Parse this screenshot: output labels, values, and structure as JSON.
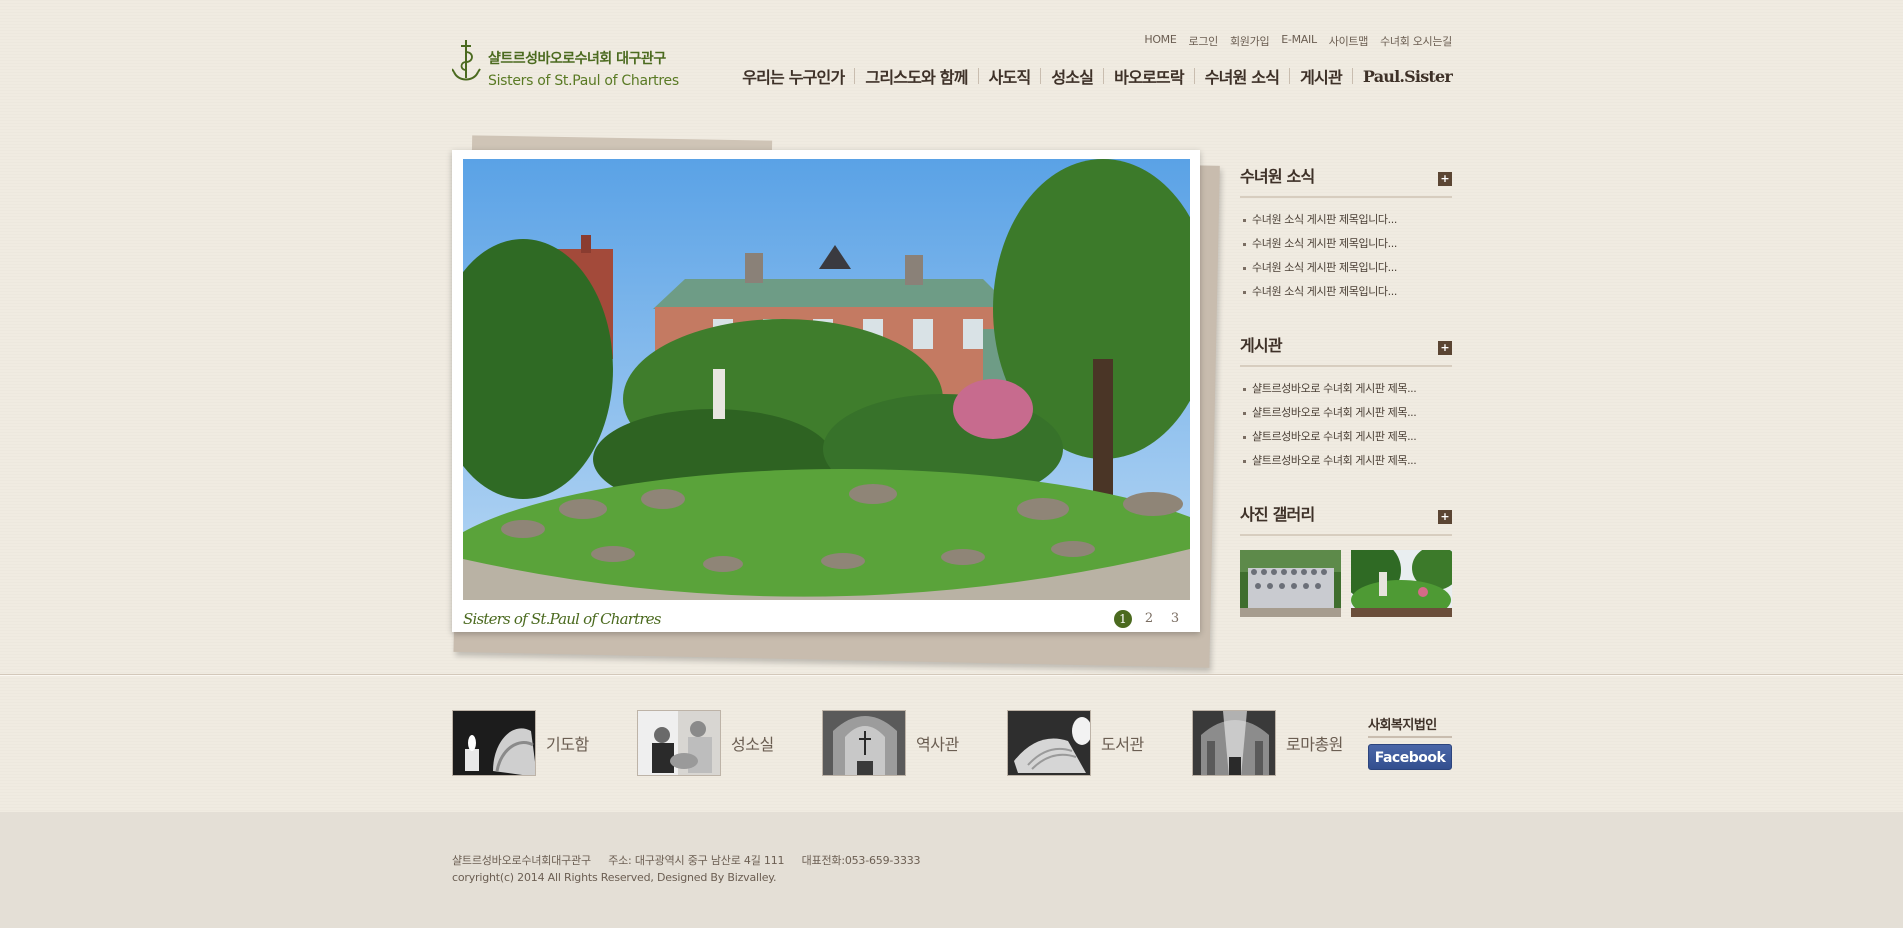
{
  "header": {
    "logo_kr": "샬트르성바오로수녀회 대구관구",
    "logo_en": "Sisters of St.Paul of Chartres",
    "util_nav": [
      "HOME",
      "로그인",
      "회원가입",
      "E-MAIL",
      "사이트맵",
      "수녀회 오시는길"
    ],
    "gnb": [
      "우리는 누구인가",
      "그리스도와 함께",
      "사도직",
      "성소실",
      "바오로뜨락",
      "수녀원 소식",
      "게시관",
      "Paul.Sister"
    ]
  },
  "visual": {
    "caption": "Sisters of St.Paul of Chartres",
    "pages": [
      "1",
      "2",
      "3"
    ],
    "active_page": 1
  },
  "sidebar": {
    "news": {
      "title": "수녀원 소식",
      "more": "+",
      "items": [
        "수녀원 소식 게시판 제목입니다...",
        "수녀원 소식 게시판 제목입니다...",
        "수녀원 소식 게시판 제목입니다...",
        "수녀원 소식 게시판 제목입니다..."
      ]
    },
    "board": {
      "title": "게시관",
      "more": "+",
      "items": [
        "샬트르성바오로 수녀회 게시판 제목...",
        "샬트르성바오로 수녀회 게시판 제목...",
        "샬트르성바오로 수녀회 게시판 제목...",
        "샬트르성바오로 수녀회 게시판 제목..."
      ]
    },
    "gallery": {
      "title": "사진 갤러리",
      "more": "+"
    }
  },
  "quick_links": [
    "기도함",
    "성소실",
    "역사관",
    "도서관",
    "로마총원"
  ],
  "corp": {
    "title": "사회복지법인",
    "facebook": "Facebook"
  },
  "footer": {
    "org": "샬트르성바오로수녀회대구관구",
    "address": "주소: 대구광역시 중구 남산로 4길 111",
    "phone": "대표전화:053-659-3333",
    "copyright": "coryright(c) 2014 All Rights Reserved, Designed By Bizvalley."
  },
  "colors": {
    "brand_green": "#4b6a1f",
    "accent_brown": "#5b4533",
    "background": "#f0ebe1",
    "footer_bg": "#e4dfd6"
  }
}
